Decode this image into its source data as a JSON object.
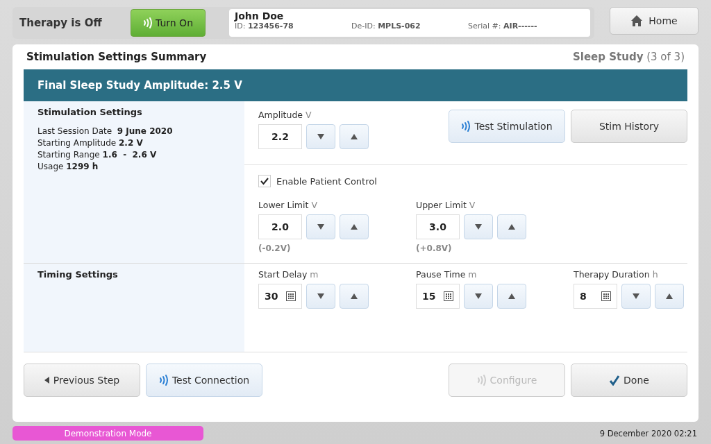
{
  "header": {
    "therapy_status": "Therapy is Off",
    "turn_on_button": {
      "label": "Turn On",
      "active": true
    },
    "patient": {
      "name": "John Doe",
      "fields": [
        {
          "label": "ID:",
          "value": "123456-78"
        },
        {
          "label": "De-ID:",
          "value": "MPLS-062"
        },
        {
          "label": "Serial #:",
          "value": "AIR------"
        }
      ]
    },
    "home_button": "Home"
  },
  "panel": {
    "title": "Stimulation Settings Summary",
    "step_label": "Sleep Study",
    "step_count": "(3 of 3)",
    "banner": "Final Sleep Study Amplitude: 2.5 V"
  },
  "stimulation": {
    "heading": "Stimulation Settings",
    "facts": [
      "Last Session Date  **9 June 2020**",
      "Starting Amplitude **2.2 V**",
      "Starting Range **1.6  -  2.6 V**",
      "Usage **1299 h**"
    ],
    "amplitude": {
      "label": "Amplitude",
      "unit": "V",
      "value": "2.2"
    },
    "actions": [
      {
        "label": "Test Stimulation",
        "kind": "wireless"
      },
      {
        "label": "Stim History",
        "kind": "plain"
      }
    ],
    "patient_control": {
      "label": "Enable Patient Control",
      "checked": true
    },
    "limits": [
      {
        "label": "Lower Limit",
        "unit": "V",
        "value": "2.0",
        "delta": "(-0.2V)"
      },
      {
        "label": "Upper Limit",
        "unit": "V",
        "value": "3.0",
        "delta": "(+0.8V)"
      }
    ]
  },
  "timing": {
    "heading": "Timing Settings",
    "fields": [
      {
        "label": "Start Delay",
        "unit": "m",
        "value": "30"
      },
      {
        "label": "Pause Time",
        "unit": "m",
        "value": "15"
      },
      {
        "label": "Therapy Duration",
        "unit": "h",
        "value": "8"
      }
    ]
  },
  "footer": [
    {
      "label": "Previous Step",
      "kind": "back",
      "disabled": false
    },
    {
      "label": "Test Connection",
      "kind": "wireless",
      "disabled": false
    },
    {
      "label": "Configure",
      "kind": "wireless",
      "disabled": true
    },
    {
      "label": "Done",
      "kind": "check",
      "disabled": false
    }
  ],
  "status_bar": {
    "mode": "Demonstration Mode",
    "datetime": "9 December 2020 02:21"
  }
}
